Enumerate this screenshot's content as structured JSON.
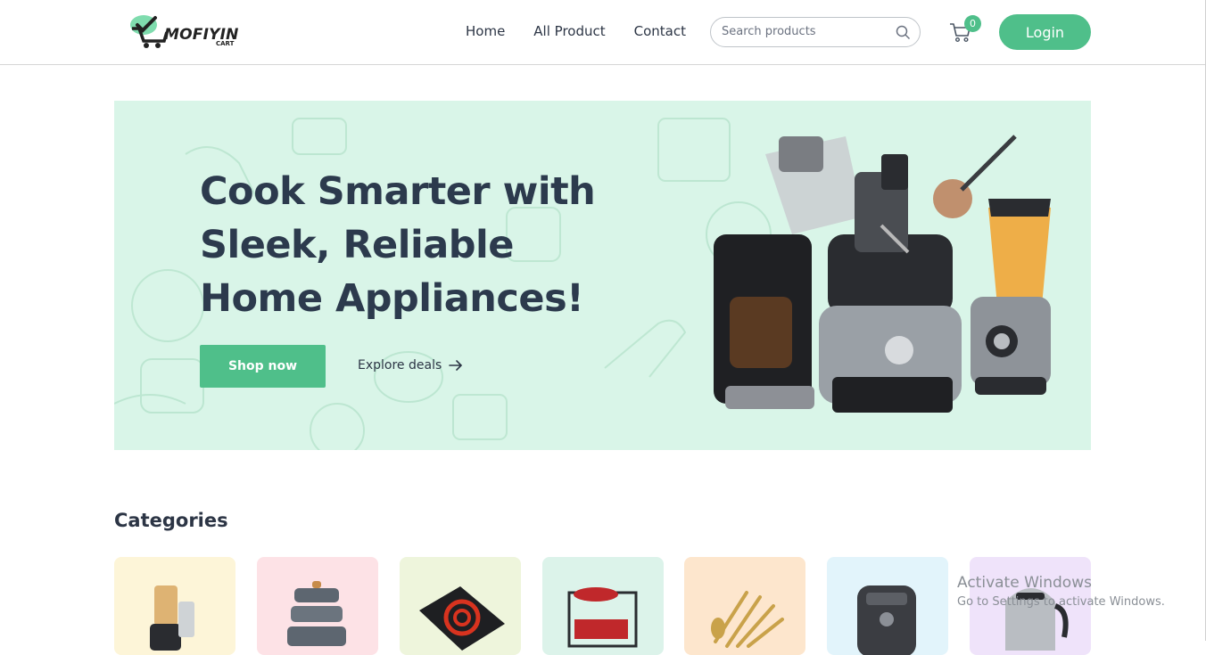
{
  "brand": {
    "name": "MOFIYIN",
    "sub": "CART"
  },
  "nav": {
    "items": [
      "Home",
      "All Product",
      "Contact"
    ]
  },
  "search": {
    "placeholder": "Search products"
  },
  "cart": {
    "count": "0"
  },
  "login_label": "Login",
  "hero": {
    "title": "Cook Smarter with Sleek, Reliable Home Appliances!",
    "shop_label": "Shop now",
    "explore_label": "Explore deals"
  },
  "categories": {
    "title": "Categories",
    "colors": [
      "#fdf5d8",
      "#fde2e6",
      "#eef5dc",
      "#dcf3ea",
      "#fde6cd",
      "#e2f4fb",
      "#efe3fa"
    ]
  },
  "watermark": {
    "line1": "Activate Windows",
    "line2": "Go to Settings to activate Windows."
  },
  "colors": {
    "accent": "#4fbf8a",
    "hero_bg": "#d9f5e8",
    "text": "#2c3a4d"
  }
}
